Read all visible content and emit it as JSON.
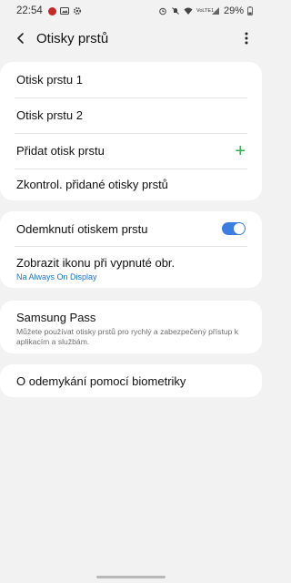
{
  "status": {
    "time": "22:54",
    "network": "VoLTE1",
    "battery": "29%"
  },
  "appbar": {
    "title": "Otisky prstů"
  },
  "fingerprints": {
    "items": [
      {
        "label": "Otisk prstu 1"
      },
      {
        "label": "Otisk prstu 2"
      }
    ],
    "add_label": "Přidat otisk prstu",
    "check_label": "Zkontrol. přidané otisky prstů"
  },
  "unlock": {
    "toggle_label": "Odemknutí otiskem prstu",
    "toggle_on": true,
    "show_icon_label": "Zobrazit ikonu při vypnuté obr.",
    "show_icon_sub": "Na Always On Display"
  },
  "samsung_pass": {
    "title": "Samsung Pass",
    "desc": "Můžete používat otisky prstů pro rychlý a zabezpečený přístup k aplikacím a službám."
  },
  "about": {
    "label": "O odemykání pomocí biometriky"
  },
  "colors": {
    "accent": "#3b7de0",
    "add_green": "#2eae4f",
    "link_blue": "#1a73c8"
  }
}
